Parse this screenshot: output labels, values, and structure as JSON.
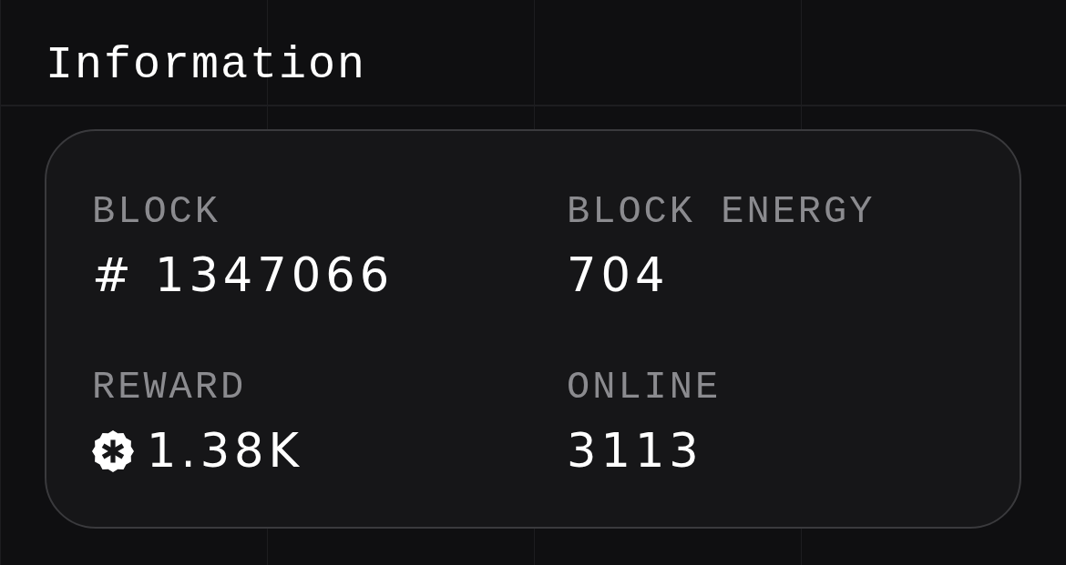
{
  "title": "Information",
  "stats": [
    {
      "label": "BLOCK",
      "kind": "plain",
      "value": "# 1347066"
    },
    {
      "label": "BLOCK ENERGY",
      "kind": "plain",
      "value": "704"
    },
    {
      "label": "REWARD",
      "kind": "token",
      "value": "1.38K"
    },
    {
      "label": "ONLINE",
      "kind": "plain",
      "value": "3113"
    }
  ]
}
